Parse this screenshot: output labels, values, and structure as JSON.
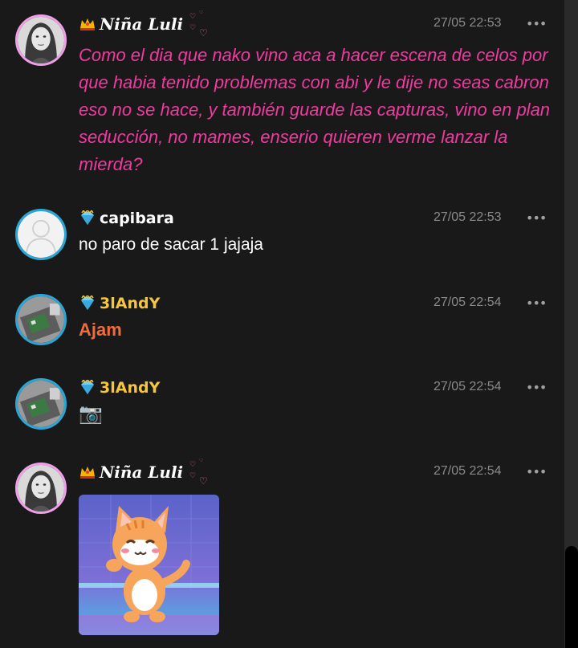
{
  "messages": [
    {
      "author": "Niña Luli",
      "time": "27/05 22:53",
      "text": "Como el dia que nako vino aca a hacer escena de celos por que habia tenido problemas con abi y le dije no seas cabron eso no se hace, y también guarde las capturas, vino en plan seducción, no mames, enserio quieren verme lanzar la mierda?",
      "text_color": "#f03aa0"
    },
    {
      "author": "capibara",
      "time": "27/05 22:53",
      "text": "no paro de sacar 1 jajaja",
      "text_color": "#ffffff"
    },
    {
      "author": "3lAndY",
      "time": "27/05 22:54",
      "text": "Ajam",
      "text_color": "#f26b3a"
    },
    {
      "author": "3lAndY",
      "time": "27/05 22:54",
      "text": "📷",
      "icon": "camera-icon"
    },
    {
      "author": "Niña Luli",
      "time": "27/05 22:54",
      "attachment": "dancing-cat-sticker"
    }
  ],
  "more_label": "•••",
  "colors": {
    "background": "#191919",
    "author_gold": "#f5c542",
    "timestamp": "#8a8a8a",
    "avatar_ring_pink": "#f0a0e8",
    "avatar_ring_blue": "#29a8d8"
  }
}
